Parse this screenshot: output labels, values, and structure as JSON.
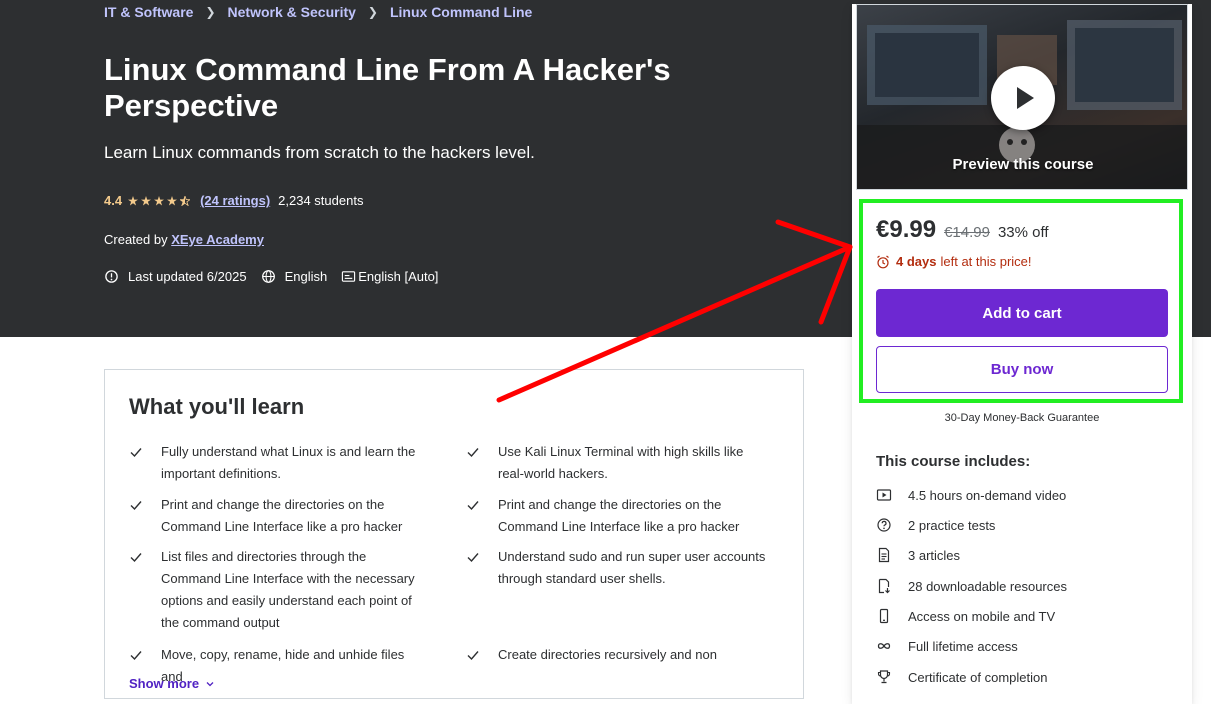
{
  "breadcrumb": [
    "IT & Software",
    "Network & Security",
    "Linux Command Line"
  ],
  "course": {
    "title": "Linux Command Line From A Hacker's Perspective",
    "subtitle": "Learn Linux commands from scratch to the hackers level.",
    "rating": "4.4",
    "stars": 4.5,
    "ratings_count": "(24 ratings)",
    "students": "2,234 students",
    "created_by_label": "Created by",
    "instructor": "XEye Academy",
    "last_updated": "Last updated 6/2025",
    "language": "English",
    "captions": "English [Auto]"
  },
  "learn": {
    "title": "What you'll learn",
    "items": [
      "Fully understand what Linux is and learn the important definitions.",
      "Use Kali Linux Terminal with high skills like real-world hackers.",
      "Print and change the directories on the Command Line Interface like a pro hacker",
      "Print and change the directories on the Command Line Interface like a pro hacker",
      "List files and directories through the Command Line Interface with the necessary options and easily understand each point of the command output",
      "Understand sudo and run super user accounts through standard user shells.",
      "Move, copy, rename, hide and unhide files and",
      "Create directories recursively and non"
    ],
    "show_more": "Show more"
  },
  "sidebar": {
    "preview_label": "Preview this course",
    "price": "€9.99",
    "original_price": "€14.99",
    "discount": "33% off",
    "timer_bold": "4 days",
    "timer_rest": "left at this price!",
    "add_to_cart": "Add to cart",
    "buy_now": "Buy now",
    "guarantee": "30-Day Money-Back Guarantee",
    "includes_title": "This course includes:",
    "includes": [
      {
        "icon": "video-icon",
        "label": "4.5 hours on-demand video"
      },
      {
        "icon": "question-icon",
        "label": "2 practice tests"
      },
      {
        "icon": "article-icon",
        "label": "3 articles"
      },
      {
        "icon": "download-icon",
        "label": "28 downloadable resources"
      },
      {
        "icon": "mobile-icon",
        "label": "Access on mobile and TV"
      },
      {
        "icon": "infinity-icon",
        "label": "Full lifetime access"
      },
      {
        "icon": "trophy-icon",
        "label": "Certificate of completion"
      }
    ]
  },
  "colors": {
    "hero_bg": "#2d2f31",
    "accent": "#6d28d2",
    "link_light": "#c0c4fc",
    "star": "#f3ca8c",
    "highlight": "#22ee22",
    "arrow": "#ff0000"
  }
}
